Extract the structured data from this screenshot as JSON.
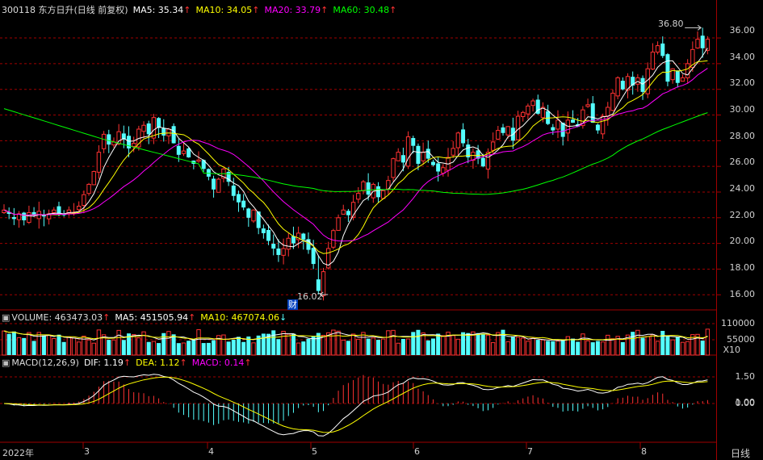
{
  "colors": {
    "up": "#ff3232",
    "down": "#54ffff",
    "ma5": "#ffffff",
    "ma10": "#ffff00",
    "ma20": "#ff00ff",
    "ma60": "#00ff00",
    "grid": "#a00000",
    "axis_text": "#d0d0d0"
  },
  "header_main": {
    "code_name": "300118 东方日升(日线 前复权)",
    "ma5": "MA5: 35.34",
    "ma10": "MA10: 34.05",
    "ma20": "MA20: 33.79",
    "ma60": "MA60: 30.48",
    "arrow_up": "↑"
  },
  "header_volume": {
    "volume": "VOLUME: 463473.03",
    "ma5": "MA5: 451505.94",
    "ma10": "MA10: 467074.06",
    "arrow_up": "↑",
    "arrow_down": "↓"
  },
  "header_macd": {
    "label": "MACD(12,26,9)",
    "dif": "DIF: 1.19",
    "dea": "DEA: 1.12",
    "macd": "MACD: 0.14",
    "arrow_up": "↑"
  },
  "price_axis": [
    "36.00",
    "34.00",
    "32.00",
    "30.00",
    "28.00",
    "26.00",
    "24.00",
    "22.00",
    "20.00",
    "18.00",
    "16.00"
  ],
  "volume_axis": [
    "110000",
    "55000",
    "X10"
  ],
  "macd_axis": [
    "1.50",
    "1.00",
    "0.00"
  ],
  "annotations": {
    "high": "36.80",
    "low": "16.02",
    "low_marker": "财"
  },
  "x_axis": {
    "labels": [
      "2022年",
      "3",
      "4",
      "5",
      "6",
      "7",
      "8"
    ],
    "period": "日线"
  },
  "chart_data": {
    "type": "candlestick",
    "price_range": [
      15.2,
      37.7
    ],
    "high": 36.8,
    "low": 16.02,
    "closes": [
      22.6,
      22.3,
      21.9,
      22.3,
      21.8,
      22.4,
      22.2,
      22.5,
      22.1,
      22.3,
      22.6,
      22.3,
      22.2,
      22.6,
      22.4,
      22.9,
      23.8,
      24.6,
      25.6,
      27.1,
      28.5,
      27.7,
      27.9,
      28.7,
      28.1,
      27.4,
      27.8,
      28.9,
      29.2,
      28.5,
      29.8,
      29.0,
      28.4,
      28.9,
      27.8,
      26.9,
      27.2,
      26.7,
      26.2,
      26.5,
      25.8,
      25.2,
      24.2,
      25.0,
      25.8,
      24.8,
      23.7,
      23.2,
      22.8,
      22.0,
      22.6,
      21.2,
      20.8,
      20.2,
      19.6,
      19.1,
      19.6,
      20.4,
      20.0,
      20.8,
      20.3,
      19.5,
      18.4,
      16.2,
      17.8,
      19.6,
      21.0,
      22.0,
      22.6,
      22.2,
      23.2,
      23.9,
      24.8,
      23.8,
      24.6,
      23.6,
      24.1,
      24.9,
      26.6,
      27.1,
      26.3,
      28.3,
      27.6,
      26.2,
      27.1,
      26.6,
      26.1,
      25.6,
      25.9,
      26.7,
      27.4,
      28.6,
      27.8,
      26.7,
      27.1,
      26.6,
      26.0,
      27.1,
      27.9,
      28.8,
      28.6,
      29.1,
      28.0,
      29.9,
      30.2,
      30.7,
      31.1,
      30.1,
      30.6,
      29.3,
      28.8,
      29.6,
      28.3,
      29.6,
      29.4,
      29.1,
      30.4,
      30.8,
      29.4,
      28.8,
      29.9,
      30.6,
      31.7,
      32.9,
      32.0,
      33.0,
      32.3,
      32.9,
      31.8,
      33.6,
      34.9,
      35.4,
      34.6,
      32.6,
      33.6,
      32.5,
      32.9,
      34.0,
      35.1,
      35.9,
      35.2,
      35.9
    ]
  }
}
